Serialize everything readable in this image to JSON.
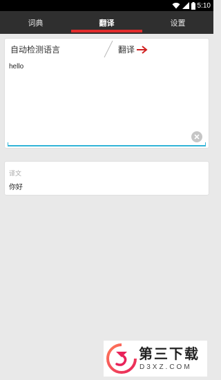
{
  "status_bar": {
    "time": "5:10"
  },
  "tabs": [
    {
      "label": "词典",
      "active": false
    },
    {
      "label": "翻译",
      "active": true
    },
    {
      "label": "设置",
      "active": false
    }
  ],
  "translator": {
    "source_lang": "自动检测语言",
    "target_lang": "翻译",
    "input_text": "hello"
  },
  "result": {
    "label": "译文",
    "text": "你好"
  },
  "watermark": {
    "title": "第三下载",
    "subtitle": "D3XZ.COM"
  },
  "colors": {
    "accent": "#e22b2b",
    "input_focus": "#2fb3d7",
    "tab_bar": "#2f2f2f"
  }
}
